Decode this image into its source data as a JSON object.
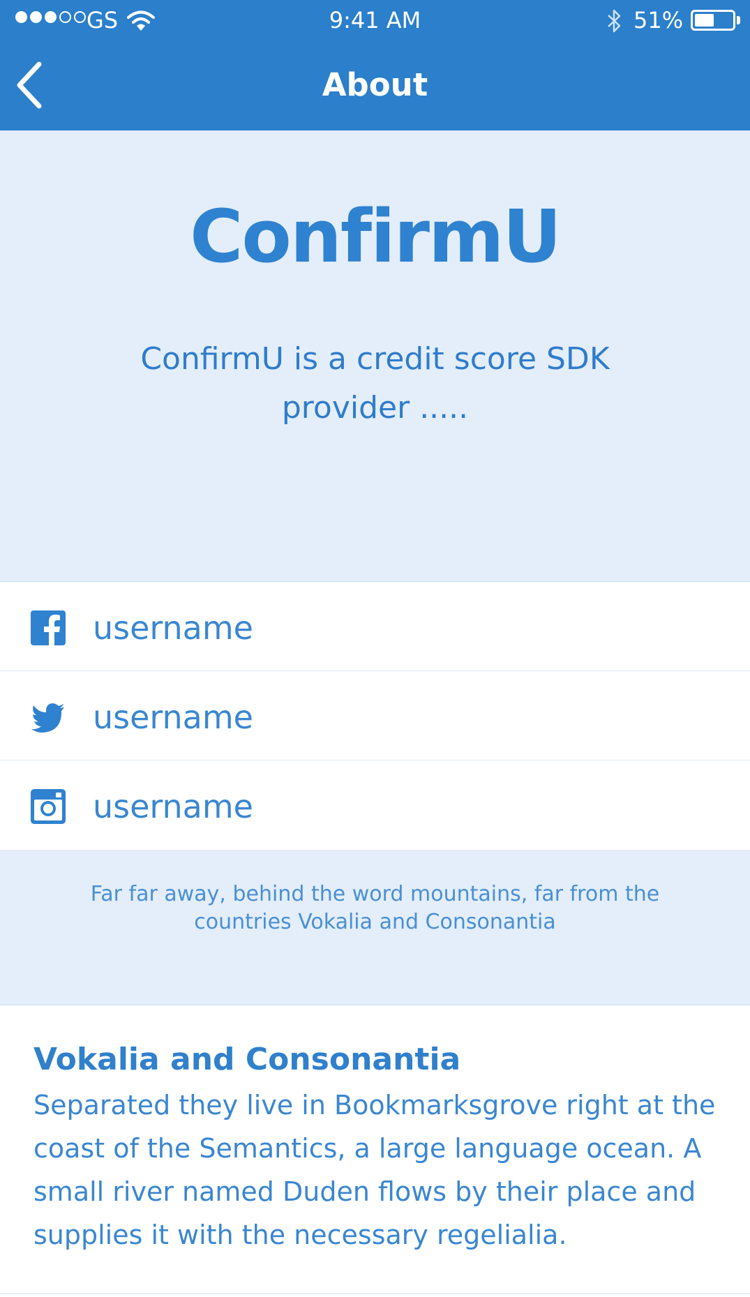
{
  "status_bar": {
    "carrier": "GS",
    "time": "9:41 AM",
    "battery_percent": "51%",
    "battery_level": 0.51
  },
  "nav": {
    "title": "About",
    "back_icon": "chevron-left-icon"
  },
  "hero": {
    "brand": "ConfirmU",
    "tagline": "ConfirmU is a credit score SDK provider ....."
  },
  "social": [
    {
      "network": "facebook",
      "icon": "facebook-icon",
      "username": "username"
    },
    {
      "network": "twitter",
      "icon": "twitter-icon",
      "username": "username"
    },
    {
      "network": "instagram",
      "icon": "instagram-icon",
      "username": "username"
    }
  ],
  "info": {
    "text": "Far far away, behind the word mountains, far from the countries Vokalia and Consonantia"
  },
  "detail": {
    "title": "Vokalia and Consonantia",
    "body": "Separated they live in Bookmarksgrove right at the coast of the Semantics, a large language ocean. A small river named Duden flows by their place and supplies it with the necessary regelialia."
  },
  "colors": {
    "primary": "#2b7fcb",
    "light_background": "#e3eefa",
    "text_blue": "#3a86d0"
  }
}
